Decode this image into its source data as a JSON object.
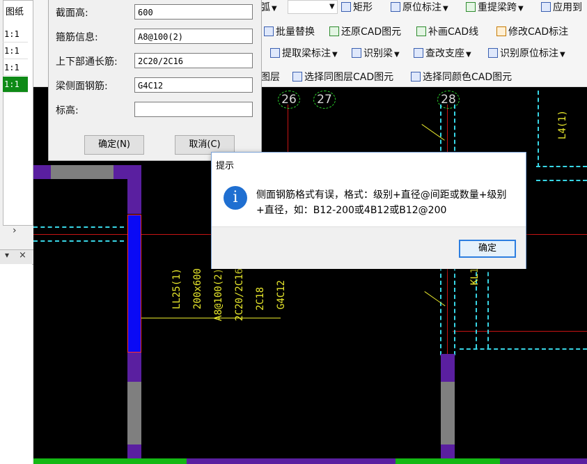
{
  "left_panel": {
    "header": "图纸",
    "rows": [
      "1:1",
      "1:1",
      "1:1",
      "1:1"
    ],
    "selected_index": 3,
    "scroll_arrow": "›",
    "pin_icon": "pin-icon",
    "close_icon": "×"
  },
  "toolbar": {
    "row1": {
      "arc_tail": "弧",
      "rect": "矩形",
      "orig_annot": "原位标注",
      "re_span": "重提梁跨",
      "apply": "应用到"
    },
    "row2": {
      "batch_replace": "批量替换",
      "restore_cad": "还原CAD图元",
      "add_cad_line": "补画CAD线",
      "modify_cad_annot": "修改CAD标注"
    },
    "row3": {
      "extract_beam_annot": "提取梁标注",
      "identify_beam": "识别梁",
      "check_support": "查改支座",
      "identify_orig_annot": "识别原位标注"
    },
    "row4": {
      "layer_tail": "图层",
      "select_same_layer": "选择同图层CAD图元",
      "select_same_color": "选择同颜色CAD图元"
    }
  },
  "form": {
    "fields": [
      {
        "label": "截面高:",
        "value": "600"
      },
      {
        "label": "箍筋信息:",
        "value": "A8@100(2)"
      },
      {
        "label": "上下部通长筋:",
        "value": "2C20/2C16"
      },
      {
        "label": "梁侧面钢筋:",
        "value": "G4C12"
      },
      {
        "label": "标高:",
        "value": ""
      }
    ],
    "ok_label": "确定(N)",
    "cancel_label": "取消(C)"
  },
  "dialog": {
    "title": "提示",
    "icon": "i",
    "message": "侧面钢筋格式有误，格式：级别+直径@间距或数量+级别+直径，如：B12-200或4B12或B12@200",
    "ok_label": "确定"
  },
  "cad": {
    "axes": [
      "26",
      "27",
      "28"
    ],
    "beam_label_lines": [
      "LL25(1)",
      "200x600",
      "A8@100(2)",
      "2C20/2C16",
      "2C18",
      "G4C12"
    ],
    "beam_l4": "L4(1)",
    "beam_kl": "KL1",
    "colors": {
      "cyan": "#38d6e6",
      "purple": "#5a1fa0",
      "gray": "#7f7f7f",
      "blue": "#0000ff",
      "red": "#c81414",
      "green": "#14b814",
      "yellow": "#e8e82c"
    }
  }
}
